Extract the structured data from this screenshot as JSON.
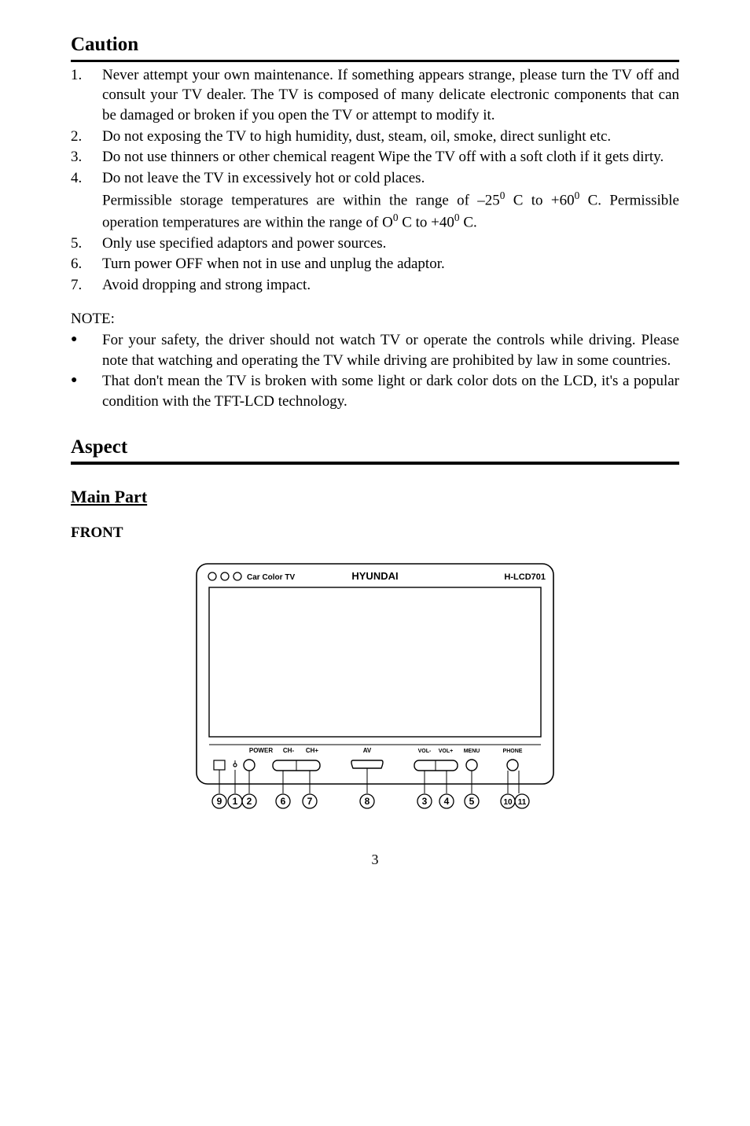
{
  "headings": {
    "caution": "Caution",
    "aspect": "Aspect",
    "main_part": "Main Part",
    "front": "FRONT"
  },
  "caution_items": [
    {
      "num": "1.",
      "text": "Never attempt your own maintenance. If something appears strange, please turn the TV off and consult your TV dealer. The TV is composed of many delicate electronic components that can be damaged or broken if you open the TV or attempt to modify it."
    },
    {
      "num": "2.",
      "text": "Do not exposing the TV to high humidity, dust, steam, oil, smoke, direct sunlight etc."
    },
    {
      "num": "3.",
      "text": "Do not use thinners or other chemical reagent Wipe the TV off with a soft cloth if it gets dirty."
    },
    {
      "num": "4.",
      "text_html": "Do not leave the TV in excessively hot or cold places.<br>Permissible storage temperatures are within the range of –25<sup>0</sup> C to +60<sup>0</sup> C. Permissible operation temperatures are within the range of O<sup>0</sup> C to +40<sup>0</sup> C."
    },
    {
      "num": "5.",
      "text": "Only use specified adaptors and power sources."
    },
    {
      "num": "6.",
      "text": "Turn power OFF when not in use and unplug the adaptor."
    },
    {
      "num": "7.",
      "text": "Avoid dropping and strong impact."
    }
  ],
  "note_label": "NOTE:",
  "note_items": [
    "For your safety, the driver should not watch TV or operate the controls while driving. Please note that watching and operating the TV while driving are prohibited by law in some countries.",
    "That don't mean the TV is broken with some light or dark color dots on the LCD, it's a popular condition with the TFT-LCD technology."
  ],
  "diagram": {
    "top_text_left": "Car Color TV",
    "top_text_center": "HYUNDAI",
    "top_text_right": "H-LCD701",
    "labels": {
      "power": "POWER",
      "chminus": "CH-",
      "chplus": "CH+",
      "av": "AV",
      "volminus": "VOL-",
      "volplus": "VOL+",
      "menu": "MENU",
      "phone": "PHONE"
    },
    "callouts": [
      "9",
      "1",
      "2",
      "6",
      "7",
      "8",
      "3",
      "4",
      "5",
      "10",
      "11"
    ]
  },
  "page_number": "3"
}
